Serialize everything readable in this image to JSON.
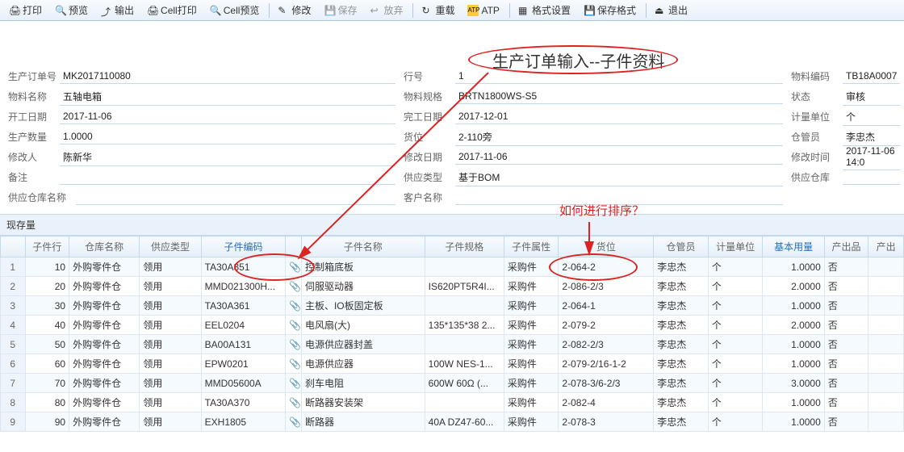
{
  "toolbar": {
    "print": "打印",
    "preview": "预览",
    "export": "输出",
    "cellPrint": "Cell打印",
    "cellPreview": "Cell预览",
    "edit": "修改",
    "save": "保存",
    "discard": "放弃",
    "reload": "重载",
    "atp": "ATP",
    "format": "格式设置",
    "saveFormat": "保存格式",
    "exit": "退出"
  },
  "annot": {
    "title": "生产订单输入--子件资料",
    "question": "如何进行排序？"
  },
  "form": {
    "left": {
      "orderNo": {
        "lbl": "生产订单号",
        "val": "MK2017110080"
      },
      "matName": {
        "lbl": "物料名称",
        "val": "五轴电箱"
      },
      "startDate": {
        "lbl": "开工日期",
        "val": "2017-11-06"
      },
      "qty": {
        "lbl": "生产数量",
        "val": "1.0000"
      },
      "modifier": {
        "lbl": "修改人",
        "val": "陈新华"
      },
      "remark": {
        "lbl": "备注",
        "val": ""
      },
      "whName": {
        "lbl": "供应仓库名称",
        "val": ""
      }
    },
    "mid": {
      "line": {
        "lbl": "行号",
        "val": "1"
      },
      "spec": {
        "lbl": "物料规格",
        "val": "BRTN1800WS-S5"
      },
      "endDate": {
        "lbl": "完工日期",
        "val": "2017-12-01"
      },
      "loc": {
        "lbl": "货位",
        "val": "2-110旁"
      },
      "modDate": {
        "lbl": "修改日期",
        "val": "2017-11-06"
      },
      "supType": {
        "lbl": "供应类型",
        "val": "基于BOM"
      },
      "cust": {
        "lbl": "客户名称",
        "val": ""
      }
    },
    "right": {
      "matCode": {
        "lbl": "物料编码",
        "val": "TB18A0007"
      },
      "status": {
        "lbl": "状态",
        "val": "审核"
      },
      "uom": {
        "lbl": "计量单位",
        "val": "个"
      },
      "keeper": {
        "lbl": "仓管员",
        "val": "李忠杰"
      },
      "modTime": {
        "lbl": "修改时间",
        "val": "2017-11-06 14:0"
      },
      "supWh": {
        "lbl": "供应仓库",
        "val": ""
      }
    }
  },
  "gridTab": "现存量",
  "cols": [
    "",
    "子件行",
    "仓库名称",
    "供应类型",
    "子件编码",
    "",
    "子件名称",
    "子件规格",
    "子件属性",
    "货位",
    "仓管员",
    "计量单位",
    "基本用量",
    "产出品",
    "产出"
  ],
  "rows": [
    {
      "n": "1",
      "line": "10",
      "wh": "外购零件仓",
      "sup": "领用",
      "code": "TA30A351",
      "name": "控制箱底板",
      "spec": "",
      "attr": "采购件",
      "loc": "2-064-2",
      "keeper": "李忠杰",
      "uom": "个",
      "qty": "1.0000",
      "out": "否"
    },
    {
      "n": "2",
      "line": "20",
      "wh": "外购零件仓",
      "sup": "领用",
      "code": "MMD021300H...",
      "name": "伺服驱动器",
      "spec": "IS620PT5R4I...",
      "attr": "采购件",
      "loc": "2-086-2/3",
      "keeper": "李忠杰",
      "uom": "个",
      "qty": "2.0000",
      "out": "否"
    },
    {
      "n": "3",
      "line": "30",
      "wh": "外购零件仓",
      "sup": "领用",
      "code": "TA30A361",
      "name": "主板、IO板固定板",
      "spec": "",
      "attr": "采购件",
      "loc": "2-064-1",
      "keeper": "李忠杰",
      "uom": "个",
      "qty": "1.0000",
      "out": "否"
    },
    {
      "n": "4",
      "line": "40",
      "wh": "外购零件仓",
      "sup": "领用",
      "code": "EEL0204",
      "name": "电风扇(大)",
      "spec": "135*135*38 2...",
      "attr": "采购件",
      "loc": "2-079-2",
      "keeper": "李忠杰",
      "uom": "个",
      "qty": "2.0000",
      "out": "否"
    },
    {
      "n": "5",
      "line": "50",
      "wh": "外购零件仓",
      "sup": "领用",
      "code": "BA00A131",
      "name": "电源供应器封盖",
      "spec": "",
      "attr": "采购件",
      "loc": "2-082-2/3",
      "keeper": "李忠杰",
      "uom": "个",
      "qty": "1.0000",
      "out": "否"
    },
    {
      "n": "6",
      "line": "60",
      "wh": "外购零件仓",
      "sup": "领用",
      "code": "EPW0201",
      "name": "电源供应器",
      "spec": "100W NES-1...",
      "attr": "采购件",
      "loc": "2-079-2/16-1-2",
      "keeper": "李忠杰",
      "uom": "个",
      "qty": "1.0000",
      "out": "否"
    },
    {
      "n": "7",
      "line": "70",
      "wh": "外购零件仓",
      "sup": "领用",
      "code": "MMD05600A",
      "name": "刹车电阻",
      "spec": "600W 60Ω (...",
      "attr": "采购件",
      "loc": "2-078-3/6-2/3",
      "keeper": "李忠杰",
      "uom": "个",
      "qty": "3.0000",
      "out": "否"
    },
    {
      "n": "8",
      "line": "80",
      "wh": "外购零件仓",
      "sup": "领用",
      "code": "TA30A370",
      "name": "断路器安装架",
      "spec": "",
      "attr": "采购件",
      "loc": "2-082-4",
      "keeper": "李忠杰",
      "uom": "个",
      "qty": "1.0000",
      "out": "否"
    },
    {
      "n": "9",
      "line": "90",
      "wh": "外购零件仓",
      "sup": "领用",
      "code": "EXH1805",
      "name": "断路器",
      "spec": "40A DZ47-60...",
      "attr": "采购件",
      "loc": "2-078-3",
      "keeper": "李忠杰",
      "uom": "个",
      "qty": "1.0000",
      "out": "否"
    }
  ]
}
